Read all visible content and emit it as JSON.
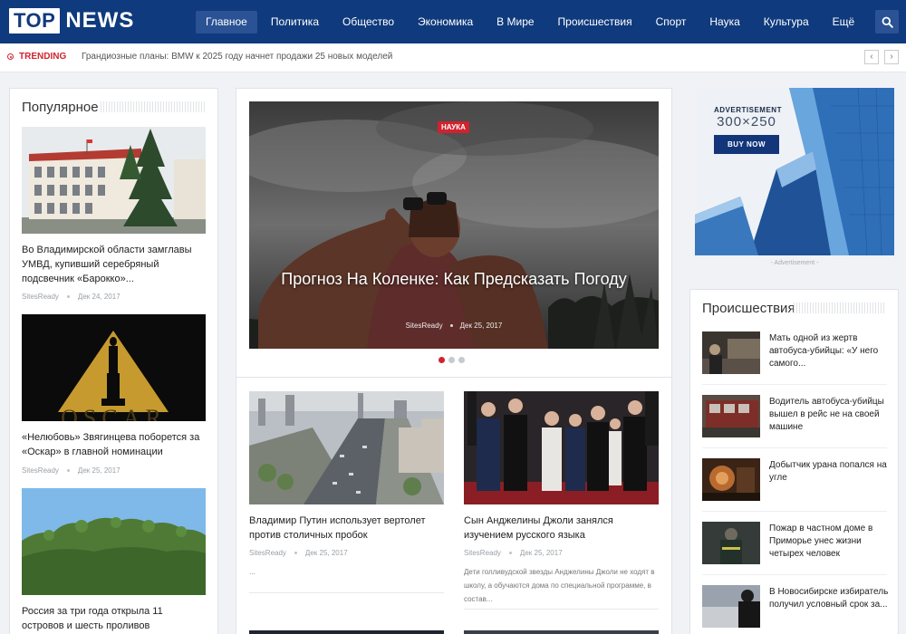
{
  "header": {
    "logo_top": "TOP",
    "logo_news": "NEWS",
    "nav": [
      {
        "label": "Главное",
        "active": true
      },
      {
        "label": "Политика"
      },
      {
        "label": "Общество"
      },
      {
        "label": "Экономика"
      },
      {
        "label": "В Мире"
      },
      {
        "label": "Происшествия"
      },
      {
        "label": "Спорт"
      },
      {
        "label": "Наука"
      },
      {
        "label": "Культура"
      },
      {
        "label": "Ещё"
      }
    ],
    "search_icon": "search-icon"
  },
  "trending": {
    "label": "TRENDING",
    "text": "Грандиозные планы: BMW к 2025 году начнет продажи 25 новых моделей",
    "prev": "‹",
    "next": "›"
  },
  "popular": {
    "title": "Популярное",
    "items": [
      {
        "title": "Во Владимирской области замглавы УМВД, купивший серебряный подсвечник «Барокко»...",
        "author": "SitesReady",
        "date": "Дек 24, 2017"
      },
      {
        "title": "«Нелюбовь» Звягинцева поборется за «Оскар» в главной номинации",
        "author": "SitesReady",
        "date": "Дек 25, 2017",
        "image_text": "OSCAR"
      },
      {
        "title": "Россия за три года открыла 11 островов и шесть проливов",
        "author": "",
        "date": ""
      }
    ]
  },
  "hero": {
    "badge": "НАУКА",
    "title": "Прогноз На Коленке: Как Предсказать Погоду",
    "author": "SitesReady",
    "date": "Дек 25, 2017"
  },
  "articles": [
    {
      "title": "Владимир Путин использует вертолет против столичных пробок",
      "author": "SitesReady",
      "date": "Дек 25, 2017",
      "excerpt": "..."
    },
    {
      "title": "Сын Анджелины Джоли занялся изучением русского языка",
      "author": "SitesReady",
      "date": "Дек 25, 2017",
      "excerpt": "Дети голливудской звезды Анджелины Джоли не ходят в школу, а обучаются дома по специальной программе, в состав..."
    }
  ],
  "ad": {
    "label": "ADVERTISEMENT",
    "size": "300×250",
    "button": "BUY NOW",
    "caption": "- Advertisement -"
  },
  "incidents": {
    "title": "Происшествия",
    "items": [
      {
        "title": "Мать одной из жертв автобуса-убийцы: «У него самого..."
      },
      {
        "title": "Водитель автобуса-убийцы вышел в рейс не на своей машине"
      },
      {
        "title": "Добытчик урана попался на угле"
      },
      {
        "title": "Пожар в частном доме в Приморье унес жизни четырех человек"
      },
      {
        "title": "В Новосибирске избиратель получил условный срок за..."
      }
    ]
  },
  "colors": {
    "header_bg": "#0f3a7d",
    "accent_red": "#d0222f",
    "nav_active": "#2a5294"
  }
}
